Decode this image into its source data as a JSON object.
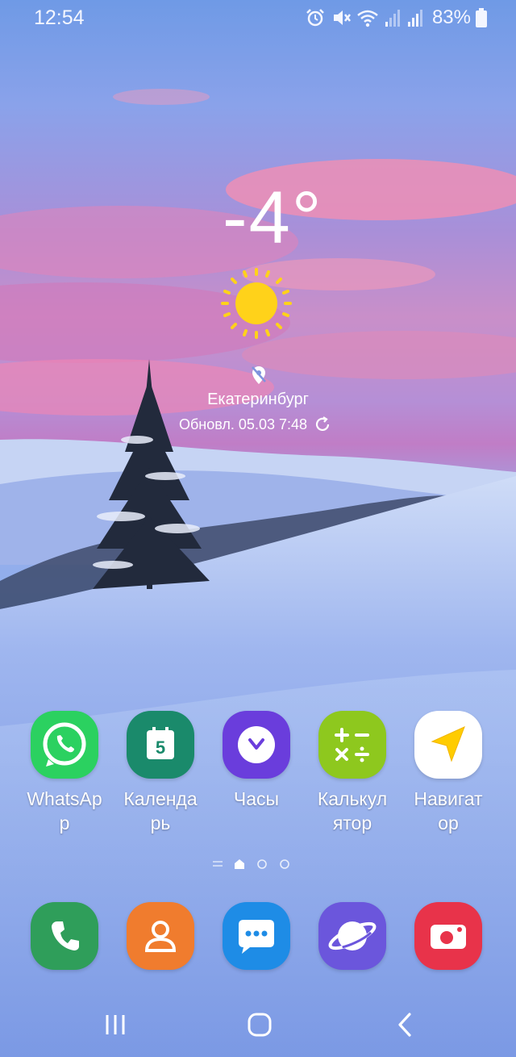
{
  "status_bar": {
    "time": "12:54",
    "icons": [
      "alarm-icon",
      "mute-icon",
      "wifi-icon",
      "signal-1-icon",
      "signal-2-icon"
    ],
    "battery": "83%"
  },
  "weather": {
    "temperature": "-4°",
    "condition_icon": "sun-icon",
    "city": "Екатеринбург",
    "updated": "Обновл. 05.03 7:48"
  },
  "apps": [
    {
      "label": "WhatsAp\nр",
      "icon": "whatsapp-icon",
      "color": "#25d366"
    },
    {
      "label": "Календа\nрь",
      "icon": "calendar-icon",
      "color": "#1a8a6b",
      "day": "5"
    },
    {
      "label": "Часы",
      "icon": "clock-icon",
      "color": "#6f3ee0"
    },
    {
      "label": "Калькул\nятор",
      "icon": "calculator-icon",
      "color": "#8ec81e"
    },
    {
      "label": "Навигат\nор",
      "icon": "navigator-icon",
      "color": "#ffffff"
    }
  ],
  "dock": [
    {
      "icon": "phone-icon",
      "color": "#2f9e5a"
    },
    {
      "icon": "contacts-icon",
      "color": "#f07c2e"
    },
    {
      "icon": "messages-icon",
      "color": "#1e8ce6"
    },
    {
      "icon": "internet-icon",
      "color": "#6b56dc"
    },
    {
      "icon": "camera-icon",
      "color": "#e8334a"
    }
  ],
  "page_indicator": {
    "pages": 3,
    "current": 1
  }
}
